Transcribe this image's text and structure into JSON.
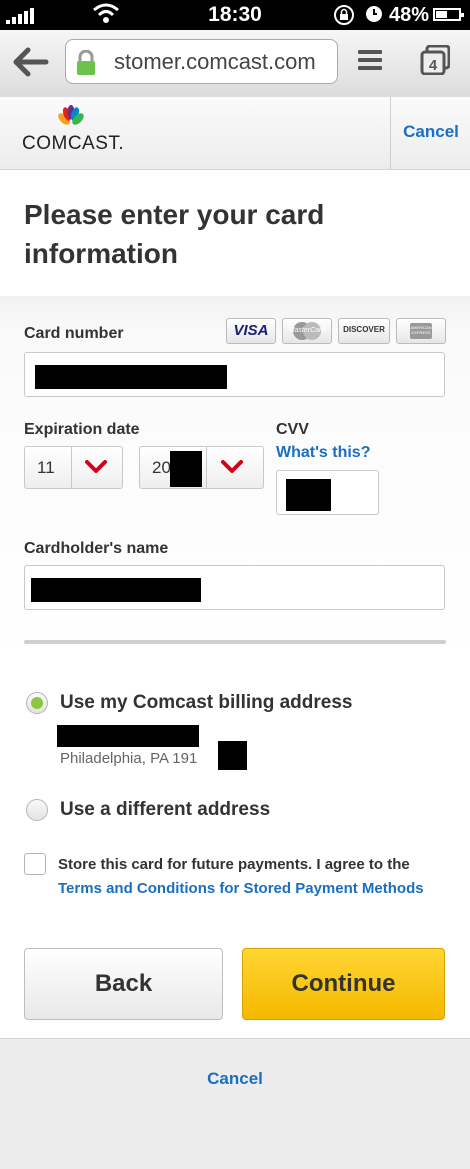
{
  "status_bar": {
    "time": "18:30",
    "battery_percent": "48%"
  },
  "browser": {
    "url_text": "stomer.comcast.com",
    "tab_count": "4"
  },
  "header": {
    "logo_text": "COMCAST.",
    "cancel_label": "Cancel"
  },
  "page": {
    "title": "Please enter your card information"
  },
  "form": {
    "card_number_label": "Card number",
    "card_brands": [
      "VISA",
      "MasterCard",
      "DISCOVER",
      "AMERICAN EXPRESS"
    ],
    "expiration_label": "Expiration date",
    "exp_month": "11",
    "exp_year_prefix": "20",
    "cvv_label": "CVV",
    "cvv_help_link": "What's this?",
    "cardholder_label": "Cardholder's name"
  },
  "address": {
    "option_billing_label": "Use my Comcast billing address",
    "billing_city_line": "Philadelphia, PA 191",
    "option_different_label": "Use a different address",
    "billing_selected": true
  },
  "store_card": {
    "text_prefix": "Store this card for future payments. I agree to the ",
    "terms_link": "Terms and Conditions for Stored Payment Methods"
  },
  "buttons": {
    "back": "Back",
    "continue": "Continue"
  },
  "footer": {
    "cancel_label": "Cancel"
  },
  "colors": {
    "link_blue": "#1a6fc1",
    "continue_yellow": "#f5b800",
    "radio_green": "#8cc63f"
  }
}
